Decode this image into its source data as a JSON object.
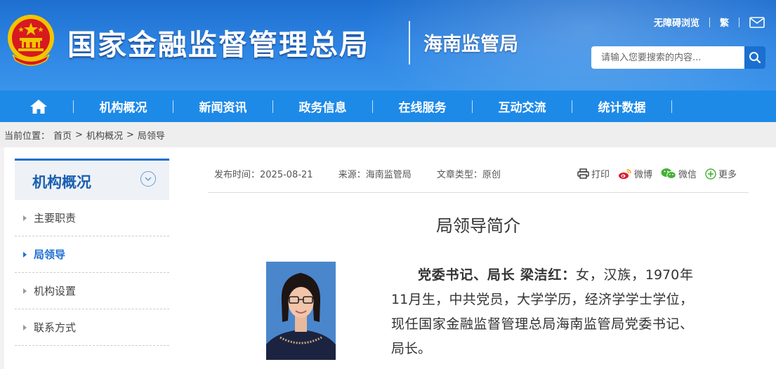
{
  "header": {
    "site_name": "国家金融监督管理总局",
    "sub_name": "海南监管局",
    "links": {
      "accessible": "无障碍浏览",
      "traditional": "繁"
    },
    "search_placeholder": "请输入您要搜索的内容...",
    "brand_color": "#1e8ae8"
  },
  "nav": {
    "home_icon": "home-icon",
    "items": [
      "机构概况",
      "新闻资讯",
      "政务信息",
      "在线服务",
      "互动交流",
      "统计数据"
    ]
  },
  "breadcrumb": {
    "label": "当前位置：",
    "items": [
      "首页",
      ">",
      "机构概况",
      ">",
      "局领导"
    ]
  },
  "sidebar": {
    "title": "机构概况",
    "items": [
      {
        "label": "主要职责",
        "active": false
      },
      {
        "label": "局领导",
        "active": true
      },
      {
        "label": "机构设置",
        "active": false
      },
      {
        "label": "联系方式",
        "active": false
      }
    ]
  },
  "article": {
    "meta": {
      "publish": "发布时间：2025-08-21",
      "source": "来源：海南监管局",
      "type": "文章类型：原创"
    },
    "share": {
      "print": "打印",
      "weibo": "微博",
      "wechat": "微信",
      "more": "更多"
    },
    "title": "局领导简介",
    "bio_heading": "党委书记、局长 梁洁红：",
    "bio_text": "女，汉族，1970年11月生，中共党员，大学学历，经济学学士学位，现任国家金融监督管理总局海南监管局党委书记、局长。"
  }
}
